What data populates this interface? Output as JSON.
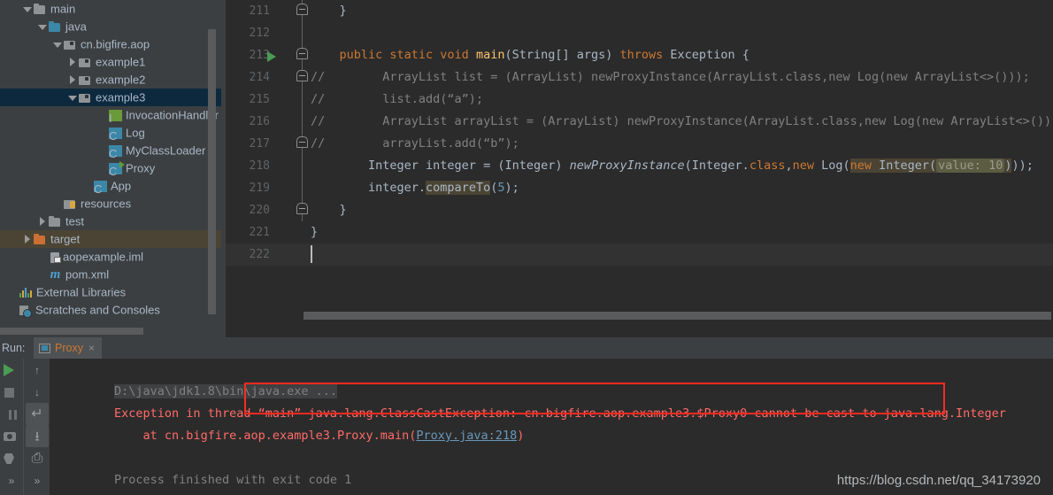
{
  "project_tree": {
    "items": [
      {
        "label": "main",
        "indent": 1,
        "arrow": "down",
        "icon": "folder-gray",
        "state": "normal"
      },
      {
        "label": "java",
        "indent": 2,
        "arrow": "down",
        "icon": "folder-blue",
        "state": "normal"
      },
      {
        "label": "cn.bigfire.aop",
        "indent": 3,
        "arrow": "down",
        "icon": "folder-pkg",
        "state": "normal"
      },
      {
        "label": "example1",
        "indent": 4,
        "arrow": "right",
        "icon": "folder-pkg",
        "state": "normal"
      },
      {
        "label": "example2",
        "indent": 4,
        "arrow": "right",
        "icon": "folder-pkg",
        "state": "normal"
      },
      {
        "label": "example3",
        "indent": 4,
        "arrow": "down",
        "icon": "folder-pkg",
        "state": "selected"
      },
      {
        "label": "InvocationHandler",
        "indent": 6,
        "arrow": "none",
        "icon": "circ-i",
        "state": "normal"
      },
      {
        "label": "Log",
        "indent": 6,
        "arrow": "none",
        "icon": "circ-c",
        "state": "normal"
      },
      {
        "label": "MyClassLoader",
        "indent": 6,
        "arrow": "none",
        "icon": "circ-c",
        "state": "normal"
      },
      {
        "label": "Proxy",
        "indent": 6,
        "arrow": "none",
        "icon": "circ-c-run",
        "state": "normal"
      },
      {
        "label": "App",
        "indent": 5,
        "arrow": "none",
        "icon": "circ-c",
        "state": "normal"
      },
      {
        "label": "resources",
        "indent": 3,
        "arrow": "none",
        "icon": "folder-res",
        "state": "normal"
      },
      {
        "label": "test",
        "indent": 2,
        "arrow": "right",
        "icon": "folder-gray",
        "state": "normal"
      },
      {
        "label": "target",
        "indent": 1,
        "arrow": "right",
        "icon": "folder-orange",
        "state": "highlight"
      },
      {
        "label": "aopexample.iml",
        "indent": 2,
        "arrow": "none",
        "icon": "iml",
        "state": "normal"
      },
      {
        "label": "pom.xml",
        "indent": 2,
        "arrow": "none",
        "icon": "mlogo",
        "state": "normal"
      },
      {
        "label": "External Libraries",
        "indent": 0,
        "arrow": "none",
        "icon": "libs",
        "state": "normal"
      },
      {
        "label": "Scratches and Consoles",
        "indent": 0,
        "arrow": "none",
        "icon": "scratch",
        "state": "normal"
      }
    ]
  },
  "editor": {
    "lines": [
      {
        "num": "211",
        "fold": "cap-end",
        "runmark": false,
        "current": false,
        "tokens": [
          {
            "t": "    }",
            "c": "punc"
          }
        ]
      },
      {
        "num": "212",
        "fold": "line",
        "runmark": false,
        "current": false,
        "tokens": []
      },
      {
        "num": "213",
        "fold": "cap-start",
        "runmark": true,
        "current": false,
        "tokens": [
          {
            "t": "    ",
            "c": "punc"
          },
          {
            "t": "public static void ",
            "c": "kw"
          },
          {
            "t": "main",
            "c": "fn"
          },
          {
            "t": "(String[] args) ",
            "c": "typ"
          },
          {
            "t": "throws ",
            "c": "kw"
          },
          {
            "t": "Exception {",
            "c": "typ"
          }
        ]
      },
      {
        "num": "214",
        "fold": "cmt-cap",
        "runmark": false,
        "current": false,
        "tokens": [
          {
            "t": "//        ArrayList list = (ArrayList) newProxyInstance(ArrayList.class,new Log(new ArrayList<>()));",
            "c": "cmt"
          }
        ]
      },
      {
        "num": "215",
        "fold": "cmt",
        "runmark": false,
        "current": false,
        "tokens": [
          {
            "t": "//        list.add(“a”);",
            "c": "cmt"
          }
        ]
      },
      {
        "num": "216",
        "fold": "cmt",
        "runmark": false,
        "current": false,
        "tokens": [
          {
            "t": "//        ArrayList arrayList = (ArrayList) newProxyInstance(ArrayList.class,new Log(new ArrayList<>()));",
            "c": "cmt"
          }
        ]
      },
      {
        "num": "217",
        "fold": "cmt-cap",
        "runmark": false,
        "current": false,
        "tokens": [
          {
            "t": "//        arrayList.add(“b”);",
            "c": "cmt"
          }
        ]
      },
      {
        "num": "218",
        "fold": "line",
        "runmark": false,
        "current": false,
        "tokens": [
          {
            "t": "        Integer integer = (Integer) ",
            "c": "typ"
          },
          {
            "t": "newProxyInstance",
            "c": "ital"
          },
          {
            "t": "(Integer.",
            "c": "typ"
          },
          {
            "t": "class",
            "c": "kw"
          },
          {
            "t": ",",
            "c": "typ"
          },
          {
            "t": "new ",
            "c": "kw"
          },
          {
            "t": "Log(",
            "c": "typ"
          },
          {
            "t": "HL_START",
            "c": "marker"
          },
          {
            "t": "new ",
            "c": "kw"
          },
          {
            "t": "Integer(",
            "c": "typ"
          },
          {
            "t": "HINT:value: 10",
            "c": "hint"
          },
          {
            "t": ")",
            "c": "typ"
          },
          {
            "t": "HL_END",
            "c": "marker"
          },
          {
            "t": "));",
            "c": "typ"
          }
        ]
      },
      {
        "num": "219",
        "fold": "line",
        "runmark": false,
        "current": false,
        "tokens": [
          {
            "t": "        integer.",
            "c": "typ"
          },
          {
            "t": "compareTo",
            "c": "hl-word"
          },
          {
            "t": "(",
            "c": "typ"
          },
          {
            "t": "5",
            "c": "num"
          },
          {
            "t": ");",
            "c": "typ"
          }
        ]
      },
      {
        "num": "220",
        "fold": "cap-end",
        "runmark": false,
        "current": false,
        "tokens": [
          {
            "t": "    }",
            "c": "punc"
          }
        ]
      },
      {
        "num": "221",
        "fold": "none",
        "runmark": false,
        "current": false,
        "tokens": [
          {
            "t": "}",
            "c": "punc"
          }
        ]
      },
      {
        "num": "222",
        "fold": "none",
        "runmark": false,
        "current": true,
        "tokens": []
      }
    ]
  },
  "run_panel": {
    "run_label": "Run:",
    "tab_label": "Proxy",
    "tab_close": "×",
    "toolbar_left": [
      {
        "name": "rerun-button",
        "glyph": "play"
      },
      {
        "name": "stop-button",
        "glyph": "stop"
      },
      {
        "name": "pause-button",
        "glyph": "pause"
      },
      {
        "name": "screenshot-button",
        "glyph": "camera"
      },
      {
        "name": "threaddump-button",
        "glyph": "bug"
      },
      {
        "name": "more-left-button",
        "glyph": "»"
      }
    ],
    "toolbar_mid": [
      {
        "name": "up-stacktrace-button",
        "glyph": "↑",
        "selected": false
      },
      {
        "name": "down-stacktrace-button",
        "glyph": "↓",
        "selected": false
      },
      {
        "name": "soft-wrap-button",
        "glyph": "wrap",
        "selected": true
      },
      {
        "name": "scroll-to-end-button",
        "glyph": "scrollend",
        "selected": true
      },
      {
        "name": "print-button",
        "glyph": "printer",
        "selected": false
      },
      {
        "name": "more-mid-button",
        "glyph": "»",
        "selected": false
      }
    ],
    "console": {
      "line1_cmd": "D:\\java\\jdk1.8\\bin\\java.exe ...",
      "line2_prefix": "Exception in thread “main” ",
      "line2_boxed": "java.lang.ClassCastException: cn.bigfire.aop.example3.$Proxy0 cannot be cast to java.lang.Integer",
      "line3_prefix": "    at cn.bigfire.aop.example3.Proxy.main(",
      "line3_link": "Proxy.java:218",
      "line3_suffix": ")",
      "line4": "Process finished with exit code 1"
    }
  },
  "watermark": "https://blog.csdn.net/qq_34173920",
  "colors": {
    "panel_bg": "#3c3f41",
    "editor_bg": "#2b2b2b",
    "selection_blue": "#0d293e",
    "highlight_olive": "#4b4434",
    "error_red": "#ff6b68",
    "box_red": "#ff2a1f",
    "keyword_orange": "#cc7832",
    "method_yellow": "#ffc66d",
    "number_blue": "#6897bb",
    "comment_gray": "#808080",
    "run_green": "#499c54"
  }
}
